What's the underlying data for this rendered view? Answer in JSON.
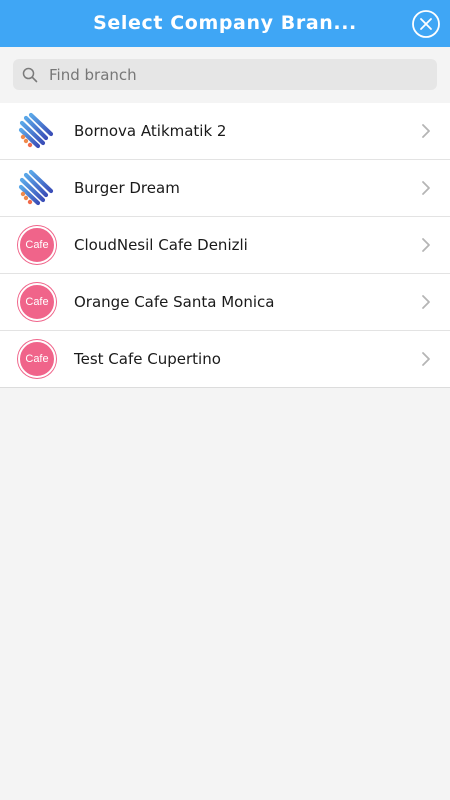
{
  "header": {
    "title": "Select Company Bran...",
    "close_icon": "close-circle-icon"
  },
  "search": {
    "placeholder": "Find branch",
    "value": "",
    "icon": "search-icon"
  },
  "branches": [
    {
      "label": "Bornova Atikmatik 2",
      "logo": "stripes-logo"
    },
    {
      "label": "Burger Dream",
      "logo": "stripes-logo"
    },
    {
      "label": "CloudNesil Cafe Denizli",
      "logo": "cafe-logo",
      "logo_text": "Cafe"
    },
    {
      "label": "Orange Cafe Santa Monica",
      "logo": "cafe-logo",
      "logo_text": "Cafe"
    },
    {
      "label": "Test Cafe Cupertino",
      "logo": "cafe-logo",
      "logo_text": "Cafe"
    }
  ],
  "colors": {
    "header": "#3fa6f5",
    "cafe_logo": "#f0648a",
    "background": "#f4f4f4"
  }
}
